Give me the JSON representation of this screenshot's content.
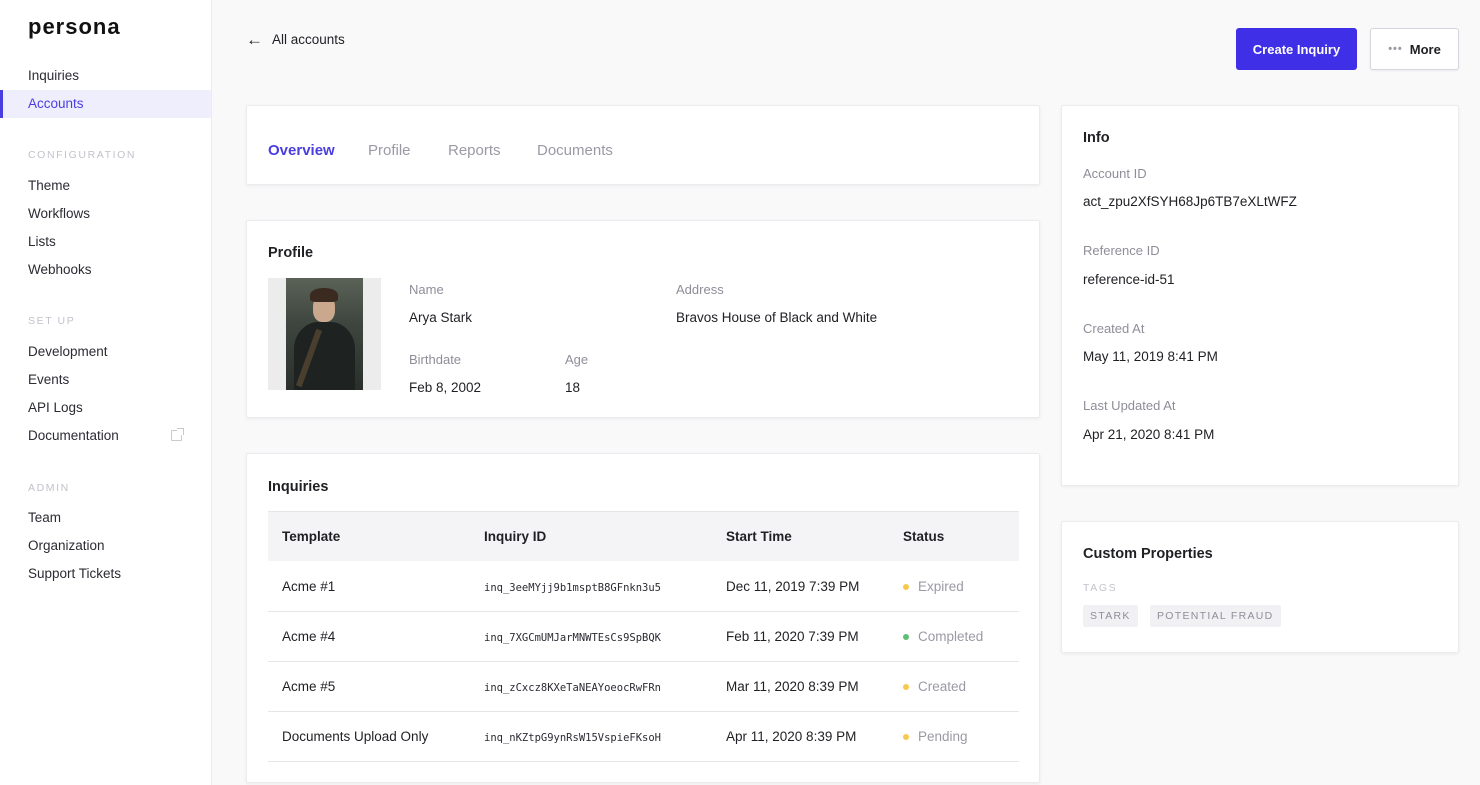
{
  "brand": {
    "logo": "persona"
  },
  "sidebar": {
    "main": [
      {
        "label": "Inquiries",
        "active": false
      },
      {
        "label": "Accounts",
        "active": true
      }
    ],
    "sections": [
      {
        "title": "CONFIGURATION",
        "items": [
          "Theme",
          "Workflows",
          "Lists",
          "Webhooks"
        ]
      },
      {
        "title": "SET UP",
        "items": [
          "Development",
          "Events",
          "API Logs",
          "Documentation"
        ]
      },
      {
        "title": "ADMIN",
        "items": [
          "Team",
          "Organization",
          "Support Tickets"
        ]
      }
    ],
    "external_link_icon": "external-link-icon"
  },
  "header": {
    "back_label": "All accounts",
    "create_label": "Create Inquiry",
    "more_label": "More",
    "more_dots": "•••"
  },
  "tabs": [
    {
      "label": "Overview",
      "active": true
    },
    {
      "label": "Profile",
      "active": false
    },
    {
      "label": "Reports",
      "active": false
    },
    {
      "label": "Documents",
      "active": false
    }
  ],
  "profile": {
    "title": "Profile",
    "name_label": "Name",
    "name": "Arya Stark",
    "address_label": "Address",
    "address": "Bravos House of Black and White",
    "birthdate_label": "Birthdate",
    "birthdate": "Feb 8, 2002",
    "age_label": "Age",
    "age": "18"
  },
  "inquiries": {
    "title": "Inquiries",
    "columns": [
      "Template",
      "Inquiry ID",
      "Start Time",
      "Status"
    ],
    "rows": [
      {
        "template": "Acme #1",
        "id": "inq_3eeMYjj9b1msptB8GFnkn3u5",
        "start": "Dec 11, 2019 7:39 PM",
        "status": "Expired"
      },
      {
        "template": "Acme #4",
        "id": "inq_7XGCmUMJarMNWTEsCs9SpBQK",
        "start": "Feb 11, 2020 7:39 PM",
        "status": "Completed"
      },
      {
        "template": "Acme #5",
        "id": "inq_zCxcz8KXeTaNEAYoeocRwFRn",
        "start": "Mar 11, 2020 8:39 PM",
        "status": "Created"
      },
      {
        "template": "Documents Upload Only",
        "id": "inq_nKZtpG9ynRsW15VspieFKsoH",
        "start": "Apr 11, 2020 8:39 PM",
        "status": "Pending"
      }
    ],
    "status_colors": {
      "Expired": "#f5c94e",
      "Completed": "#5cbf73",
      "Created": "#f5c94e",
      "Pending": "#f5c94e"
    }
  },
  "info": {
    "title": "Info",
    "account_id_label": "Account ID",
    "account_id": "act_zpu2XfSYH68Jp6TB7eXLtWFZ",
    "reference_id_label": "Reference ID",
    "reference_id": "reference-id-51",
    "created_at_label": "Created At",
    "created_at": "May 11, 2019 8:41 PM",
    "updated_at_label": "Last Updated At",
    "updated_at": "Apr 21, 2020 8:41 PM"
  },
  "custom_properties": {
    "title": "Custom Properties",
    "tags_label": "TAGS",
    "tags": [
      "STARK",
      "POTENTIAL FRAUD"
    ]
  },
  "colors": {
    "accent": "#4a3ee0",
    "primary_button": "#3f2fe6"
  }
}
